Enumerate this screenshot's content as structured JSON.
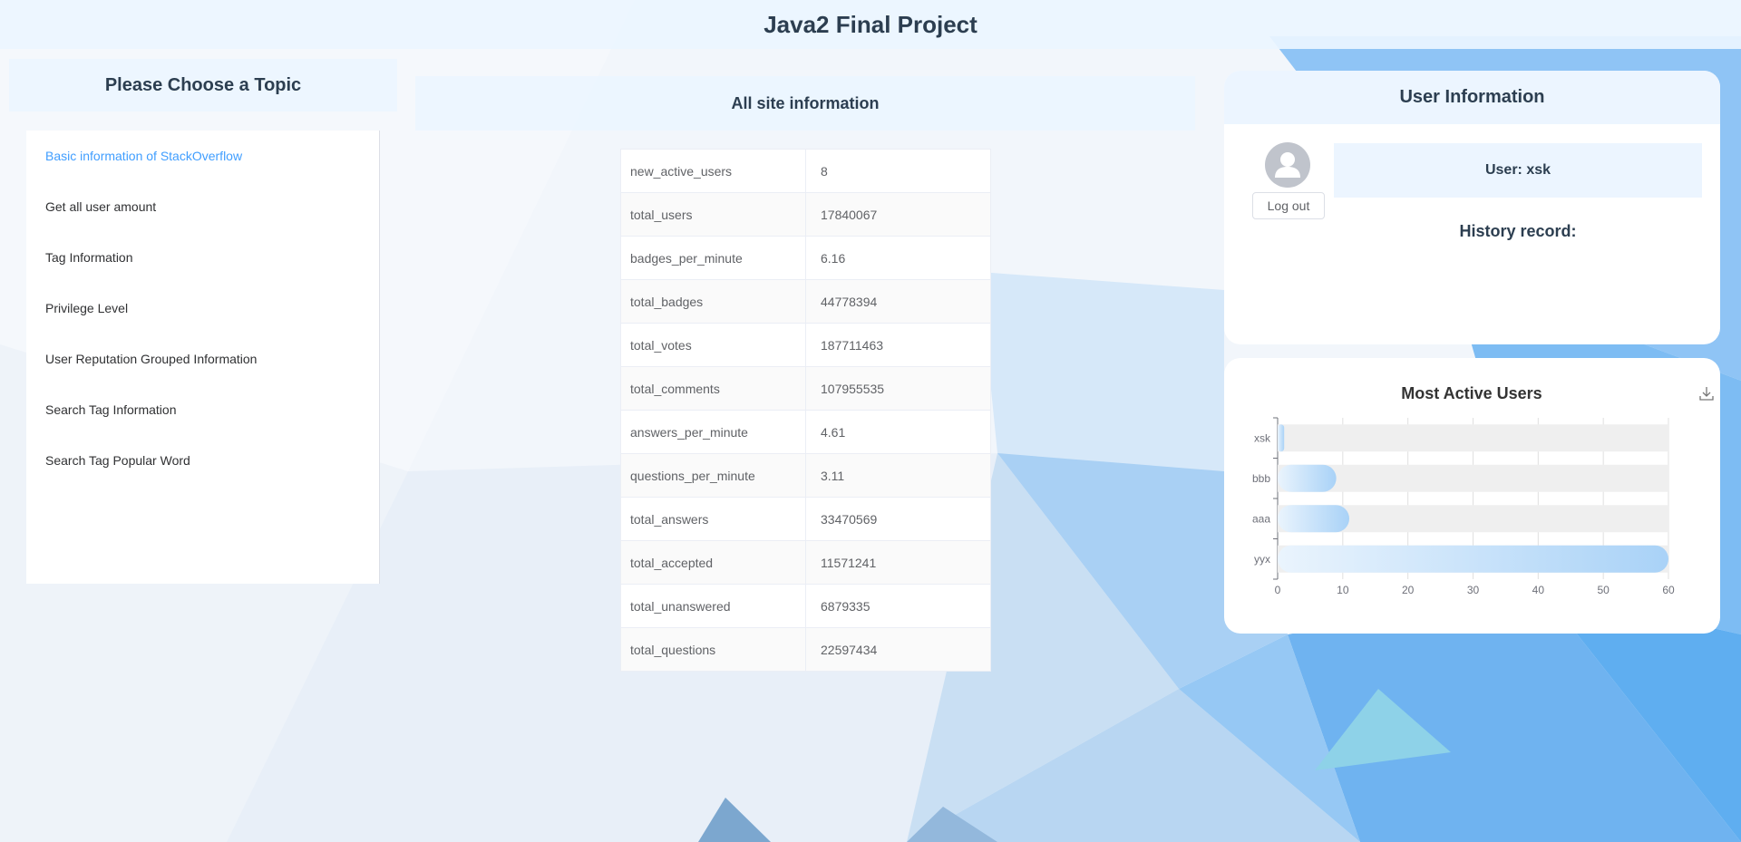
{
  "header": {
    "title": "Java2 Final Project"
  },
  "sidebar": {
    "title": "Please Choose a Topic",
    "items": [
      {
        "label": "Basic information of StackOverflow",
        "active": true
      },
      {
        "label": "Get all user amount"
      },
      {
        "label": "Tag Information"
      },
      {
        "label": "Privilege Level"
      },
      {
        "label": "User Reputation Grouped Information"
      },
      {
        "label": "Search Tag Information"
      },
      {
        "label": "Search Tag Popular Word"
      }
    ]
  },
  "main": {
    "title": "All site information",
    "table": [
      {
        "key": "new_active_users",
        "value": "8"
      },
      {
        "key": "total_users",
        "value": "17840067"
      },
      {
        "key": "badges_per_minute",
        "value": "6.16"
      },
      {
        "key": "total_badges",
        "value": "44778394"
      },
      {
        "key": "total_votes",
        "value": "187711463"
      },
      {
        "key": "total_comments",
        "value": "107955535"
      },
      {
        "key": "answers_per_minute",
        "value": "4.61"
      },
      {
        "key": "questions_per_minute",
        "value": "3.11"
      },
      {
        "key": "total_answers",
        "value": "33470569"
      },
      {
        "key": "total_accepted",
        "value": "11571241"
      },
      {
        "key": "total_unanswered",
        "value": "6879335"
      },
      {
        "key": "total_questions",
        "value": "22597434"
      }
    ]
  },
  "user_panel": {
    "title": "User Information",
    "user_label": "User: xsk",
    "logout_label": "Log out",
    "history_label": "History record:",
    "avatar_icon": "user-avatar-icon"
  },
  "chart_panel": {
    "download_icon": "download-icon"
  },
  "colors": {
    "accent": "#409eff",
    "bar_start": "#eaf4fd",
    "bar_end": "#a9d2f7",
    "track": "#efefef"
  },
  "chart_data": {
    "type": "bar",
    "orientation": "horizontal",
    "title": "Most Active Users",
    "categories": [
      "xsk",
      "bbb",
      "aaa",
      "yyx"
    ],
    "values": [
      1,
      9,
      11,
      60
    ],
    "xlim": [
      0,
      60
    ],
    "xticks": [
      0,
      10,
      20,
      30,
      40,
      50,
      60
    ],
    "grid": true,
    "legend": "none"
  }
}
